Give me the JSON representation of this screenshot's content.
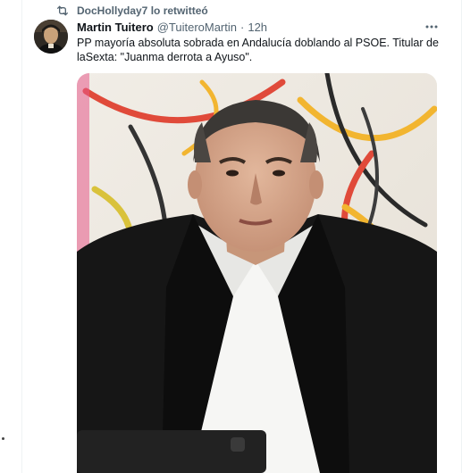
{
  "retweet": {
    "text": "DocHollyday7 lo retwitteó",
    "icon": "retweet-icon"
  },
  "tweet": {
    "author_name": "Martin Tuitero",
    "author_handle": "@TuiteroMartin",
    "separator": "·",
    "time": "12h",
    "text": "PP mayoría absoluta sobrada en Andalucía doblando al PSOE. Titular de laSexta: \"Juanma derrota a Ayuso\".",
    "more_icon": "more-horizontal-icon"
  },
  "colors": {
    "secondary_text": "#536471",
    "primary_text": "#0f1419",
    "divider": "#eff3f4"
  }
}
